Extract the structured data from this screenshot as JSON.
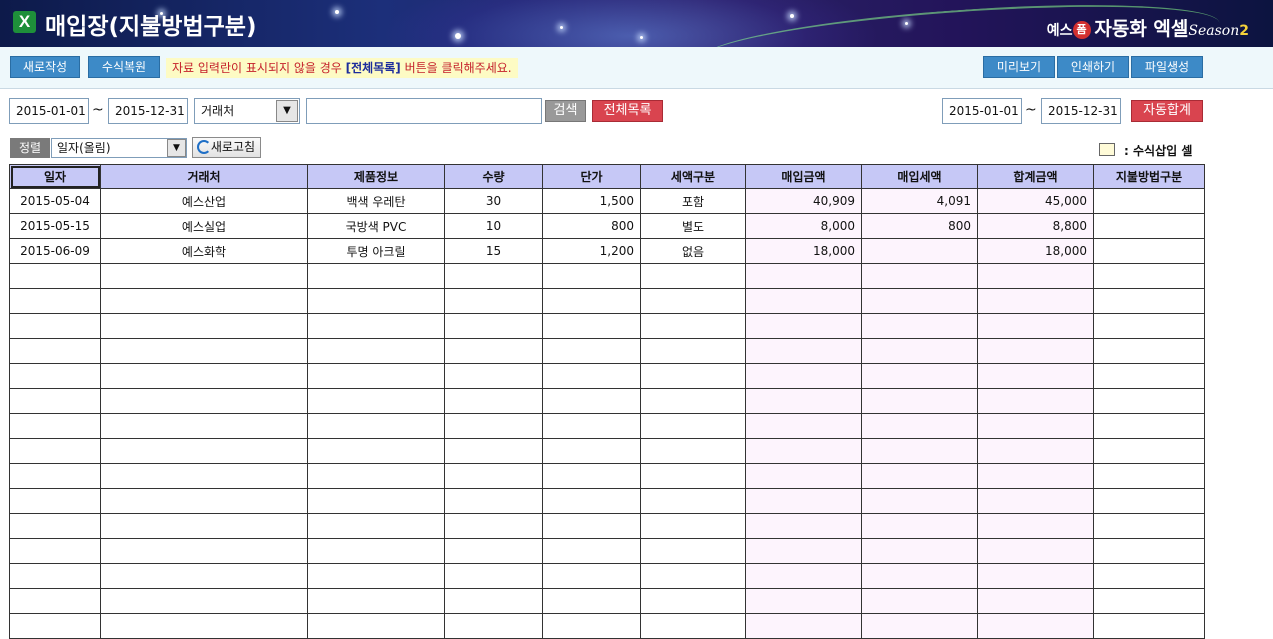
{
  "header": {
    "title": "매입장(지불방법구분)",
    "brand_prefix": "예스",
    "brand_mark": "폼",
    "brand_name": "자동화 엑셀",
    "brand_season": "Season",
    "brand_season_num": "2"
  },
  "toolbar": {
    "new_label": "새로작성",
    "restore_label": "수식복원",
    "notice_before": "자료 입력란이 표시되지  않을 경우 ",
    "notice_highlight": "[전체목록]",
    "notice_after": " 버튼을 클릭해주세요.",
    "preview_label": "미리보기",
    "print_label": "인쇄하기",
    "export_label": "파일생성"
  },
  "filter": {
    "start_date": "2015-01-01",
    "tilde": "~",
    "end_date": "2015-12-31",
    "field_select": "거래처",
    "keyword": "",
    "search_label": "검색",
    "all_list_label": "전체목록",
    "sum_start_date": "2015-01-01",
    "sum_end_date": "2015-12-31",
    "auto_sum_label": "자동합계"
  },
  "sort": {
    "label": "정렬",
    "selected": "일자(올림)",
    "refresh_label": "새로고침"
  },
  "legend": {
    "colon": ":",
    "label": "수식삽입 셀"
  },
  "colors": {
    "header_row": "#c6c8f6",
    "formula_cell": "#fdf4fd",
    "button_blue": "#3d8ac7",
    "button_red": "#d9444f",
    "button_gray": "#999999"
  },
  "table": {
    "columns": [
      "일자",
      "거래처",
      "제품정보",
      "수량",
      "단가",
      "세액구분",
      "매입금액",
      "매입세액",
      "합계금액",
      "지불방법구분"
    ],
    "rows": [
      [
        "2015-05-04",
        "예스산업",
        "백색 우레탄",
        "30",
        "1,500",
        "포함",
        "40,909",
        "4,091",
        "45,000",
        ""
      ],
      [
        "2015-05-15",
        "예스실업",
        "국방색 PVC",
        "10",
        "800",
        "별도",
        "8,000",
        "800",
        "8,800",
        ""
      ],
      [
        "2015-06-09",
        "예스화학",
        "투명 아크릴",
        "15",
        "1,200",
        "없음",
        "18,000",
        "",
        "18,000",
        ""
      ]
    ],
    "empty_rows": 15
  }
}
